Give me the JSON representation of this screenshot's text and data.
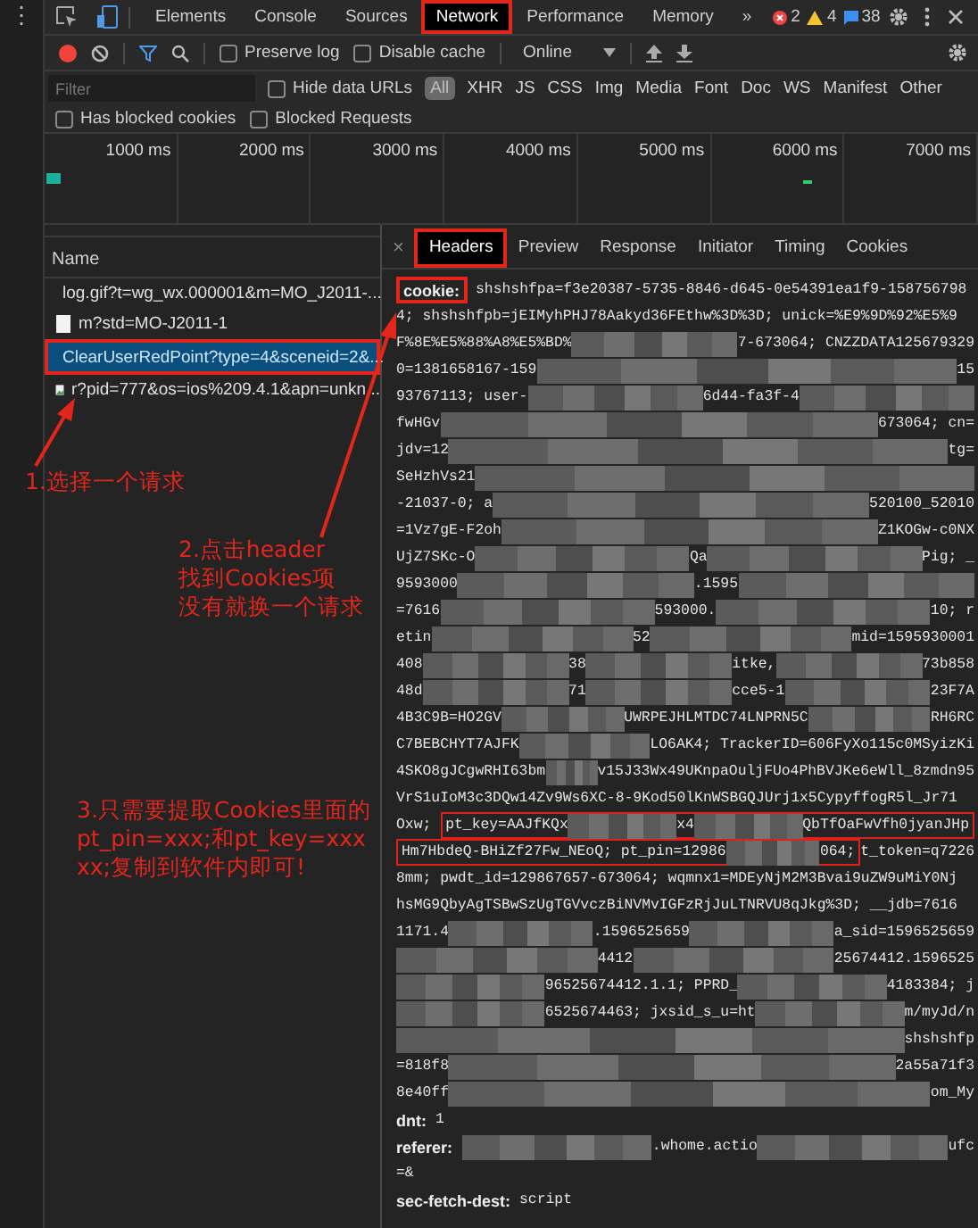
{
  "devtools": {
    "menu_glyph": "⋮",
    "tabs": [
      {
        "label": "Elements",
        "selected": false
      },
      {
        "label": "Console",
        "selected": false
      },
      {
        "label": "Sources",
        "selected": false
      },
      {
        "label": "Network",
        "selected": true,
        "highlighted": true
      },
      {
        "label": "Performance",
        "selected": false
      },
      {
        "label": "Memory",
        "selected": false
      }
    ],
    "more_tabs": "»",
    "issue_counts": {
      "errors": "2",
      "warnings": "4",
      "messages": "38"
    },
    "toolbar": {
      "preserve_log": {
        "label": "Preserve log",
        "checked": false
      },
      "disable_cache": {
        "label": "Disable cache",
        "checked": false
      },
      "throttling": "Online"
    },
    "filter": {
      "placeholder": "Filter",
      "hide_data_urls": {
        "label": "Hide data URLs",
        "checked": false
      },
      "types": [
        {
          "label": "All",
          "selected": true
        },
        {
          "label": "XHR",
          "selected": false
        },
        {
          "label": "JS",
          "selected": false
        },
        {
          "label": "CSS",
          "selected": false
        },
        {
          "label": "Img",
          "selected": false
        },
        {
          "label": "Media",
          "selected": false
        },
        {
          "label": "Font",
          "selected": false
        },
        {
          "label": "Doc",
          "selected": false
        },
        {
          "label": "WS",
          "selected": false
        },
        {
          "label": "Manifest",
          "selected": false
        },
        {
          "label": "Other",
          "selected": false
        }
      ],
      "has_blocked_cookies": {
        "label": "Has blocked cookies",
        "checked": false
      },
      "blocked_requests": {
        "label": "Blocked Requests",
        "checked": false
      }
    },
    "timeline": {
      "ticks": [
        "1000 ms",
        "2000 ms",
        "3000 ms",
        "4000 ms",
        "5000 ms",
        "6000 ms",
        "7000 ms"
      ]
    },
    "requests": {
      "column": "Name",
      "rows": [
        {
          "name": "log.gif?t=wg_wx.000001&m=MO_J2011-...",
          "kind": "document",
          "selected": false
        },
        {
          "name": "m?std=MO-J2011-1",
          "kind": "document",
          "selected": false
        },
        {
          "name": "ClearUserRedPoint?type=4&sceneid=2&...",
          "kind": "document",
          "selected": true,
          "highlighted": true
        },
        {
          "name": "r?pid=777&os=ios%209.4.1&apn=unkn...",
          "kind": "image",
          "selected": false
        }
      ]
    },
    "details": {
      "close": "×",
      "tabs": [
        {
          "label": "Headers",
          "selected": true,
          "highlighted": true
        },
        {
          "label": "Preview",
          "selected": false
        },
        {
          "label": "Response",
          "selected": false
        },
        {
          "label": "Initiator",
          "selected": false
        },
        {
          "label": "Timing",
          "selected": false
        },
        {
          "label": "Cookies",
          "selected": false
        }
      ],
      "headers": [
        {
          "name": "cookie:",
          "highlighted": true,
          "lines": [
            [
              "shshshfpa=f3e20387-5735-8846-d645-0e54391ea1f9-158756798"
            ],
            [
              "4; shshshfpb=jEIMyhPHJ78Aakyd36FEthw%3D%3D; unick=%E9%9D%92%E5%9"
            ],
            [
              "F%8E%E5%88%A8%E5%BD%",
              {
                "kind": "blurred"
              },
              "7-673064; CNZZDATA125679329"
            ],
            [
              "0=1381658167-159",
              {
                "kind": "blurred"
              },
              "15"
            ],
            [
              "93767113; user-",
              {
                "kind": "blurred"
              },
              "6d44-fa3f-4",
              {
                "kind": "blurred"
              }
            ],
            [
              "fwHGv",
              {
                "kind": "blurred"
              },
              "673064; cn="
            ],
            [
              "jdv=12",
              {
                "kind": "blurred"
              },
              "tg="
            ],
            [
              "SeHzhVs21",
              {
                "kind": "blurred"
              }
            ],
            [
              "-21037-0; a",
              {
                "kind": "blurred"
              },
              "520100_52010"
            ],
            [
              "=1Vz7gE-F2oh",
              {
                "kind": "blurred"
              },
              "Z1KOGw-c0NX"
            ],
            [
              "UjZ7SKc-O",
              {
                "kind": "blurred"
              },
              "Qa",
              {
                "kind": "blurred"
              },
              "Pig; _"
            ],
            [
              "9593000",
              {
                "kind": "blurred"
              },
              ".1595",
              {
                "kind": "blurred"
              }
            ],
            [
              "=7616",
              {
                "kind": "blurred"
              },
              "593000.",
              {
                "kind": "blurred"
              },
              "10; r"
            ],
            [
              "etin",
              {
                "kind": "blurred"
              },
              "52",
              {
                "kind": "blurred"
              },
              "mid=1595930001"
            ],
            [
              "408",
              {
                "kind": "blurred"
              },
              "38",
              {
                "kind": "blurred"
              },
              "itke,",
              {
                "kind": "blurred"
              },
              "73b858"
            ],
            [
              "48d",
              {
                "kind": "blurred"
              },
              "71",
              {
                "kind": "blurred"
              },
              "cce5-1",
              {
                "kind": "blurred"
              },
              "23F7A"
            ],
            [
              "4B3C9B=HO2GV",
              {
                "kind": "blurred"
              },
              "UWRPEJHLMTDC74LNPRN5C",
              {
                "kind": "blurred"
              },
              "RH6RC"
            ],
            [
              "C7BEBCHYT7AJFK",
              {
                "kind": "blurred"
              },
              "LO6AK4; TrackerID=606FyXo115c0MSyizKi"
            ],
            [
              "4SKO8gJCgwRHI63bm",
              {
                "kind": "blurred"
              },
              "v15J33Wx49UKnpaOuljFUo4PhBVJKe6eWll_8zmdn95"
            ],
            [
              "VrS1uIoM3c3DQw14Zv9Ws6XC-8-9Kod50lKnWSBGQJUrj1x5CypyffogR5l_Jr71"
            ],
            [
              "Oxw; ",
              {
                "kind": "boxed",
                "parts": [
                  "pt_key=AAJfKQx",
                  {
                    "kind": "blurred"
                  },
                  "x4",
                  {
                    "kind": "blurred"
                  },
                  "QbTfOaFwVfh0jyanJHp"
                ]
              }
            ],
            [
              {
                "kind": "boxed",
                "parts": [
                  "Hm7HbdeQ-BHiZf27Fw_NEoQ; pt_pin=12986",
                  {
                    "kind": "blurred"
                  },
                  "064;"
                ]
              },
              "t_token=q7226"
            ],
            [
              "8mm; pwdt_id=129867657-673064; wqmnx1=MDEyNjM2M3Bvai9uZW9uMiY0Nj"
            ],
            [
              "hsMG9QbyAgTSBwSzUgTGVvczBiNVMvIGFzRjJuLTNRVU8qJkg%3D; __jdb=7616"
            ],
            [
              "1171.4",
              {
                "kind": "blurred"
              },
              ".1596525659",
              {
                "kind": "blurred"
              },
              "a_sid=1596525659"
            ],
            [
              {
                "kind": "blurred"
              },
              "4412",
              {
                "kind": "blurred"
              },
              "25674412.1596525"
            ],
            [
              {
                "kind": "blurred"
              },
              "96525674412.1.1; PPRD_",
              {
                "kind": "blurred"
              },
              "4183384; j"
            ],
            [
              {
                "kind": "blurred"
              },
              "6525674463; jxsid_s_u=ht",
              {
                "kind": "blurred"
              },
              "m/myJd/n"
            ],
            [
              {
                "kind": "blurred"
              },
              "shshshfp"
            ],
            [
              "=818f8",
              {
                "kind": "blurred"
              },
              "2a55a71f3"
            ],
            [
              "8e40ff",
              {
                "kind": "blurred"
              },
              "om_My"
            ]
          ]
        },
        {
          "name": "dnt:",
          "lines": [
            [
              "1"
            ]
          ]
        },
        {
          "name": "referer:",
          "lines": [
            [
              {
                "kind": "blurred"
              },
              ".whome.actio",
              {
                "kind": "blurred"
              },
              "ufc"
            ],
            [
              "=&"
            ]
          ]
        },
        {
          "name": "sec-fetch-dest:",
          "lines": [
            [
              "script"
            ]
          ]
        }
      ]
    }
  },
  "annotations": [
    {
      "lines": [
        "1.选择一个请求"
      ]
    },
    {
      "lines": [
        "2.点击header",
        "找到Cookies项",
        "没有就换一个请求"
      ]
    },
    {
      "lines": [
        "3.只需要提取Cookies里面的",
        "pt_pin=xxx;和pt_key=xxx",
        "xx;复制到软件内即可!"
      ]
    }
  ]
}
